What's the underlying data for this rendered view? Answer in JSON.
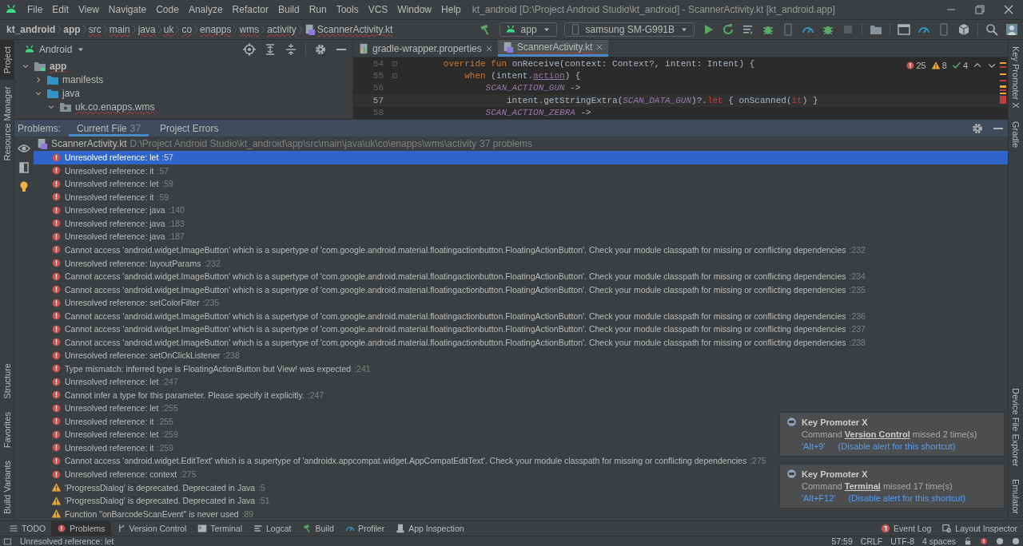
{
  "menu_bar": {
    "items": [
      "File",
      "Edit",
      "View",
      "Navigate",
      "Code",
      "Analyze",
      "Refactor",
      "Build",
      "Run",
      "Tools",
      "VCS",
      "Window",
      "Help"
    ],
    "title": "kt_android [D:\\Project Android Studio\\kt_android] - ScannerActivity.kt [kt_android.app]"
  },
  "breadcrumbs": [
    {
      "label": "kt_android",
      "kind": "project"
    },
    {
      "label": "app",
      "kind": "module"
    },
    {
      "label": "src",
      "kind": "package"
    },
    {
      "label": "main",
      "kind": "package"
    },
    {
      "label": "java",
      "kind": "package"
    },
    {
      "label": "uk",
      "kind": "package"
    },
    {
      "label": "co",
      "kind": "package"
    },
    {
      "label": "enapps",
      "kind": "package"
    },
    {
      "label": "wms",
      "kind": "package"
    },
    {
      "label": "activity",
      "kind": "package"
    },
    {
      "label": "ScannerActivity.kt",
      "kind": "file"
    }
  ],
  "run_config": "app",
  "device": "samsung SM-G991B",
  "side_tabs": {
    "left_top": [
      {
        "label": "Project",
        "selected": true
      },
      {
        "label": "Resource Manager",
        "selected": false
      }
    ],
    "left_bottom": [
      {
        "label": "Structure",
        "selected": false
      },
      {
        "label": "Favorites",
        "selected": false
      },
      {
        "label": "Build Variants",
        "selected": false
      }
    ],
    "right_top": [
      {
        "label": "Key Promoter X",
        "selected": false
      },
      {
        "label": "Gradle",
        "selected": false
      }
    ],
    "right_bottom": [
      {
        "label": "Device File Explorer",
        "selected": false
      },
      {
        "label": "Emulator",
        "selected": false
      }
    ]
  },
  "project_panel": {
    "view": "Android",
    "tree": [
      {
        "label": "app",
        "kind": "module",
        "expanded": true,
        "children": [
          {
            "label": "manifests",
            "kind": "folder",
            "expanded": false
          },
          {
            "label": "java",
            "kind": "folder",
            "expanded": true,
            "children": [
              {
                "label": "uk.co.enapps.wms",
                "kind": "package",
                "expanded": true
              }
            ]
          }
        ]
      }
    ]
  },
  "editor": {
    "tabs": [
      {
        "label": "gradle-wrapper.properties",
        "selected": false
      },
      {
        "label": "ScannerActivity.kt",
        "selected": true
      }
    ],
    "lines": [
      {
        "number": "54",
        "current": false,
        "tokens": [
          {
            "kind": "keyword",
            "text": "        override fun "
          },
          {
            "kind": "plain",
            "text": "onReceive(context: Context?, intent: Intent) {"
          }
        ]
      },
      {
        "number": "55",
        "current": false,
        "tokens": [
          {
            "kind": "keyword",
            "text": "            when "
          },
          {
            "kind": "plain",
            "text": "(intent."
          },
          {
            "kind": "extension",
            "text": "action"
          },
          {
            "kind": "plain",
            "text": ") {"
          }
        ]
      },
      {
        "number": "56",
        "current": false,
        "tokens": [
          {
            "kind": "constant",
            "text": "                SCAN_ACTION_GUN"
          },
          {
            "kind": "plain",
            "text": " ->"
          }
        ]
      },
      {
        "number": "57",
        "current": true,
        "tokens": [
          {
            "kind": "plain",
            "text": "                    intent.getStringExtra("
          },
          {
            "kind": "constant",
            "text": "SCAN_DATA_GUN"
          },
          {
            "kind": "plain",
            "text": ")?."
          },
          {
            "kind": "error",
            "text": "let"
          },
          {
            "kind": "plain",
            "text": " { onScanned("
          },
          {
            "kind": "error",
            "text": "it"
          },
          {
            "kind": "plain",
            "text": ") }"
          }
        ]
      },
      {
        "number": "58",
        "current": false,
        "tokens": [
          {
            "kind": "constant",
            "text": "                SCAN_ACTION_ZEBRA"
          },
          {
            "kind": "plain",
            "text": " ->"
          }
        ]
      }
    ],
    "inspection": {
      "errors": "25",
      "warnings": "8",
      "weak_warnings": "4"
    }
  },
  "problems": {
    "label": "Problems:",
    "tabs": [
      {
        "label": "Current File",
        "count": "37",
        "selected": true
      },
      {
        "label": "Project Errors",
        "selected": false
      }
    ],
    "file": {
      "name": "ScannerActivity.kt",
      "path": "D:\\Project Android Studio\\kt_android\\app\\src\\main\\java\\uk\\co\\enapps\\wms\\activity",
      "count": "37 problems"
    },
    "items": [
      {
        "kind": "error",
        "text": "Unresolved reference: let",
        "line": ":57",
        "selected": true
      },
      {
        "kind": "error",
        "text": "Unresolved reference: it",
        "line": ":57",
        "selected": false
      },
      {
        "kind": "error",
        "text": "Unresolved reference: let",
        "line": ":59",
        "selected": false
      },
      {
        "kind": "error",
        "text": "Unresolved reference: it",
        "line": ":59",
        "selected": false
      },
      {
        "kind": "error",
        "text": "Unresolved reference: java",
        "line": ":140",
        "selected": false
      },
      {
        "kind": "error",
        "text": "Unresolved reference: java",
        "line": ":183",
        "selected": false
      },
      {
        "kind": "error",
        "text": "Unresolved reference: java",
        "line": ":187",
        "selected": false
      },
      {
        "kind": "error",
        "text": "Cannot access 'android.widget.ImageButton' which is a supertype of 'com.google.android.material.floatingactionbutton.FloatingActionButton'. Check your module classpath for missing or conflicting dependencies",
        "line": ":232",
        "selected": false
      },
      {
        "kind": "error",
        "text": "Unresolved reference: layoutParams",
        "line": ":232",
        "selected": false
      },
      {
        "kind": "error",
        "text": "Cannot access 'android.widget.ImageButton' which is a supertype of 'com.google.android.material.floatingactionbutton.FloatingActionButton'. Check your module classpath for missing or conflicting dependencies",
        "line": ":234",
        "selected": false
      },
      {
        "kind": "error",
        "text": "Cannot access 'android.widget.ImageButton' which is a supertype of 'com.google.android.material.floatingactionbutton.FloatingActionButton'. Check your module classpath for missing or conflicting dependencies",
        "line": ":235",
        "selected": false
      },
      {
        "kind": "error",
        "text": "Unresolved reference: setColorFilter",
        "line": ":235",
        "selected": false
      },
      {
        "kind": "error",
        "text": "Cannot access 'android.widget.ImageButton' which is a supertype of 'com.google.android.material.floatingactionbutton.FloatingActionButton'. Check your module classpath for missing or conflicting dependencies",
        "line": ":236",
        "selected": false
      },
      {
        "kind": "error",
        "text": "Cannot access 'android.widget.ImageButton' which is a supertype of 'com.google.android.material.floatingactionbutton.FloatingActionButton'. Check your module classpath for missing or conflicting dependencies",
        "line": ":237",
        "selected": false
      },
      {
        "kind": "error",
        "text": "Cannot access 'android.widget.ImageButton' which is a supertype of 'com.google.android.material.floatingactionbutton.FloatingActionButton'. Check your module classpath for missing or conflicting dependencies",
        "line": ":238",
        "selected": false
      },
      {
        "kind": "error",
        "text": "Unresolved reference: setOnClickListener",
        "line": ":238",
        "selected": false
      },
      {
        "kind": "error",
        "text": "Type mismatch: inferred type is FloatingActionButton but View! was expected",
        "line": ":241",
        "selected": false
      },
      {
        "kind": "error",
        "text": "Unresolved reference: let",
        "line": ":247",
        "selected": false
      },
      {
        "kind": "error",
        "text": "Cannot infer a type for this parameter. Please specify it explicitly.",
        "line": ":247",
        "selected": false
      },
      {
        "kind": "error",
        "text": "Unresolved reference: let",
        "line": ":255",
        "selected": false
      },
      {
        "kind": "error",
        "text": "Unresolved reference: it",
        "line": ":255",
        "selected": false
      },
      {
        "kind": "error",
        "text": "Unresolved reference: let",
        "line": ":259",
        "selected": false
      },
      {
        "kind": "error",
        "text": "Unresolved reference: it",
        "line": ":259",
        "selected": false
      },
      {
        "kind": "error",
        "text": "Cannot access 'android.widget.EditText' which is a supertype of 'androidx.appcompat.widget.AppCompatEditText'. Check your module classpath for missing or conflicting dependencies",
        "line": ":275",
        "selected": false
      },
      {
        "kind": "error",
        "text": "Unresolved reference: context",
        "line": ":275",
        "selected": false
      },
      {
        "kind": "warning",
        "text": "'ProgressDialog' is deprecated. Deprecated in Java",
        "line": ":5",
        "selected": false
      },
      {
        "kind": "warning",
        "text": "'ProgressDialog' is deprecated. Deprecated in Java",
        "line": ":51",
        "selected": false
      },
      {
        "kind": "warning",
        "text": "Function \"onBarcodeScanEvent\" is never used",
        "line": ":89",
        "selected": false
      }
    ]
  },
  "notifications": [
    {
      "title": "Key Promoter X",
      "message": "Command **Version Control** missed 2 time(s)",
      "shortcut": "'Alt+9'",
      "action": "(Disable alert for this shortcut)"
    },
    {
      "title": "Key Promoter X",
      "message": "Command **Terminal** missed 17 time(s)",
      "shortcut": "'Alt+F12'",
      "action": "(Disable alert for this shortcut)"
    }
  ],
  "tool_windows": [
    {
      "label": "TODO",
      "kind": "todo",
      "selected": false
    },
    {
      "label": "Problems",
      "kind": "problems",
      "selected": true
    },
    {
      "label": "Version Control",
      "kind": "vcs",
      "selected": false
    },
    {
      "label": "Terminal",
      "kind": "terminal",
      "selected": false
    },
    {
      "label": "Logcat",
      "kind": "logcat",
      "selected": false
    },
    {
      "label": "Build",
      "kind": "build",
      "selected": false
    },
    {
      "label": "Profiler",
      "kind": "profiler",
      "selected": false
    },
    {
      "label": "App Inspection",
      "kind": "inspection",
      "selected": false
    }
  ],
  "tool_windows_right": [
    {
      "label": "Event Log",
      "kind": "event-log",
      "selected": false
    },
    {
      "label": "Layout Inspector",
      "kind": "layout-inspector",
      "selected": false
    }
  ],
  "status_bar": {
    "message": "Unresolved reference: let",
    "position": "57:59",
    "line_separator": "CRLF",
    "encoding": "UTF-8",
    "indent": "4 spaces"
  }
}
